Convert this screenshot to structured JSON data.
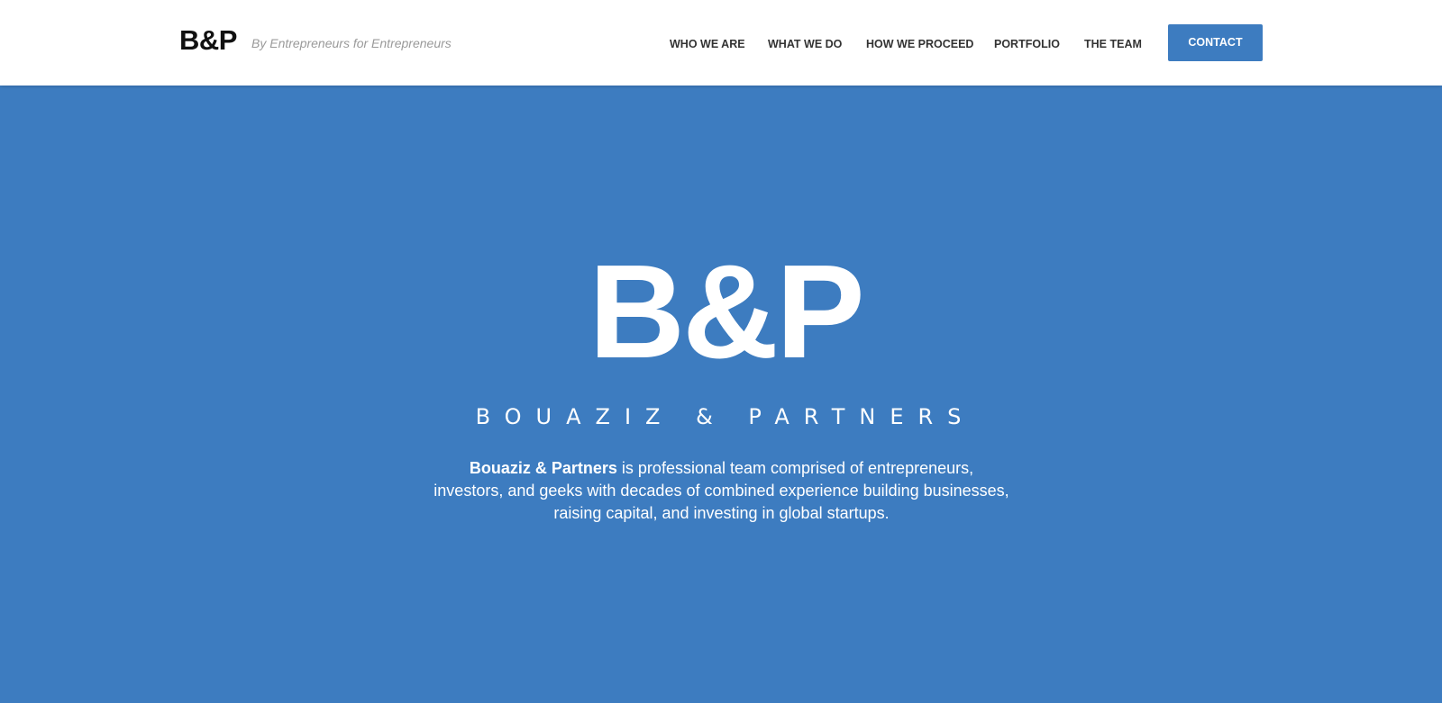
{
  "header": {
    "logo": "B&P",
    "tagline": "By Entrepreneurs for Entrepreneurs",
    "nav": {
      "who_we_are": "WHO WE ARE",
      "what_we_do": "WHAT WE DO",
      "how_we_proceed": "HOW WE PROCEED",
      "portfolio": "PORTFOLIO",
      "the_team": "THE TEAM"
    },
    "contact_label": "CONTACT"
  },
  "hero": {
    "logo": "B&P",
    "name": "BOUAZIZ & PARTNERS",
    "description_bold": "Bouaziz & Partners",
    "description_rest": " is professional team comprised of entrepreneurs, investors, and geeks with decades of combined experience building businesses, raising capital, and investing in global startups."
  },
  "colors": {
    "brand_blue": "#3d7cc0",
    "header_bg": "#ffffff",
    "nav_text": "#333333",
    "tagline_text": "#9a9a9a"
  }
}
